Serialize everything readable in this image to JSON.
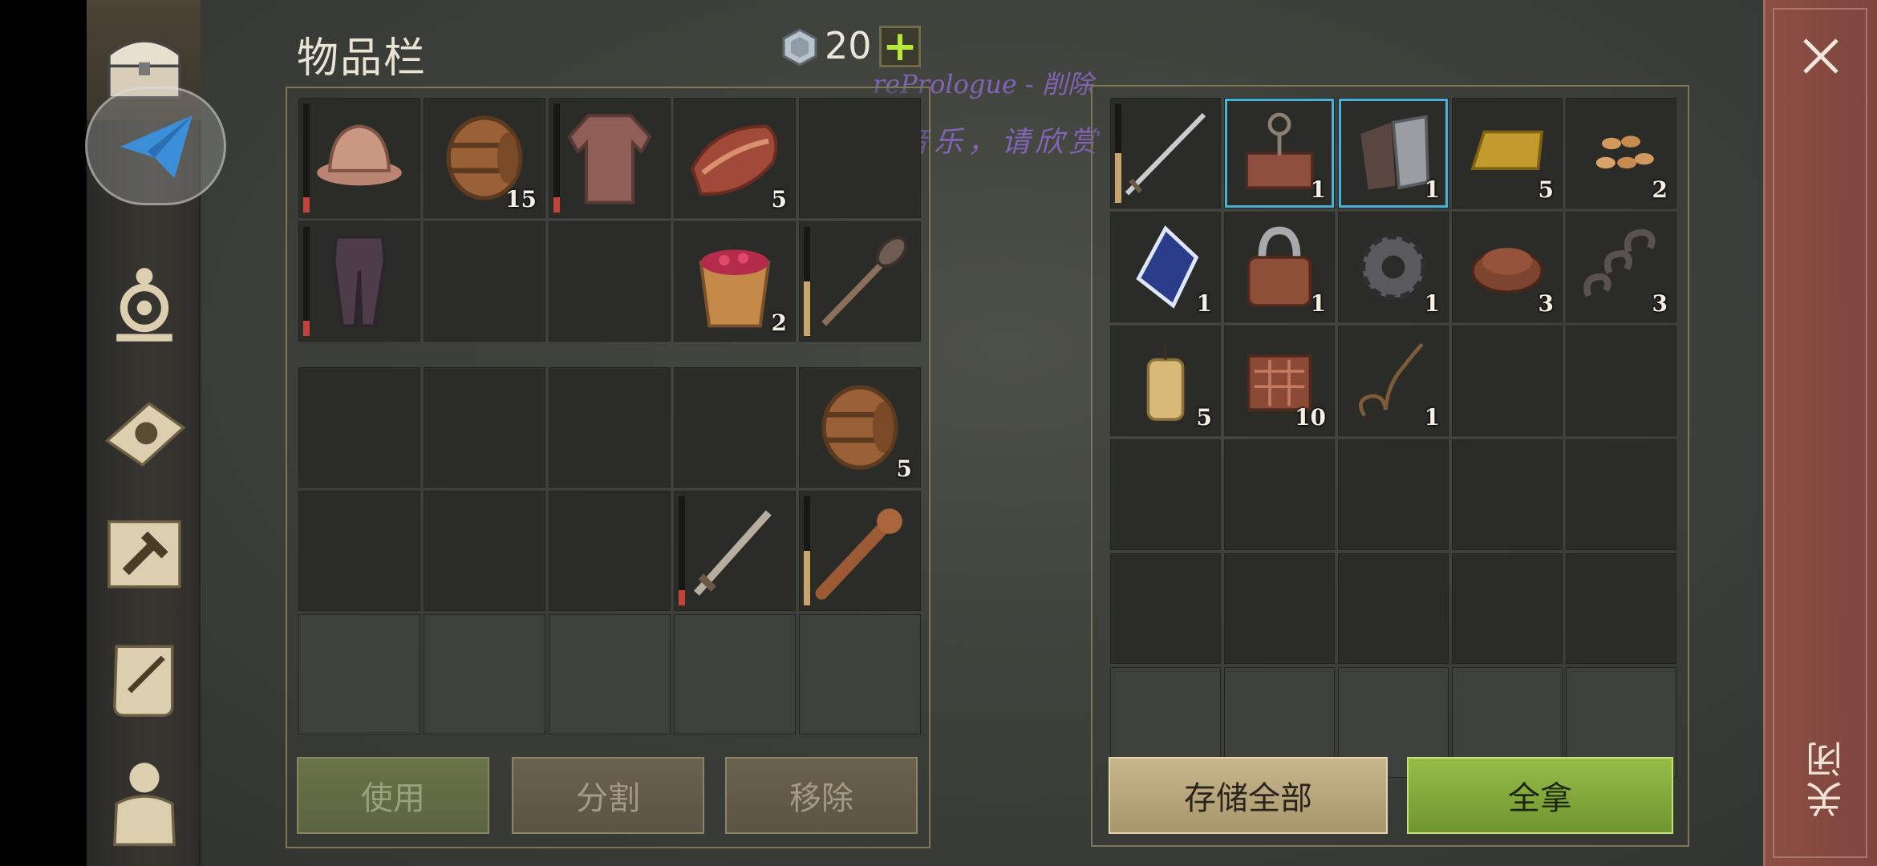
{
  "inventory": {
    "title": "物品栏",
    "currency": {
      "value": "20",
      "icon": "stone-coin-icon",
      "add": "+"
    }
  },
  "overlay": {
    "line1": "rePrologue - 削除",
    "line2": "纯音乐，请欣赏"
  },
  "player_slots": [
    {
      "item": "helmet-icon",
      "qty": "",
      "durability": "red"
    },
    {
      "item": "barrel-icon",
      "qty": "15",
      "durability": ""
    },
    {
      "item": "chainmail-icon",
      "qty": "",
      "durability": "red"
    },
    {
      "item": "meat-icon",
      "qty": "5",
      "durability": ""
    },
    {
      "item": "",
      "qty": "",
      "durability": ""
    },
    {
      "item": "pants-icon",
      "qty": "",
      "durability": "red"
    },
    {
      "item": "",
      "qty": "",
      "durability": ""
    },
    {
      "item": "",
      "qty": "",
      "durability": ""
    },
    {
      "item": "berry-bucket-icon",
      "qty": "2",
      "durability": ""
    },
    {
      "item": "mace-icon",
      "qty": "",
      "durability": "tan"
    }
  ],
  "backpack_slots": [
    {
      "item": "",
      "qty": "",
      "durability": ""
    },
    {
      "item": "",
      "qty": "",
      "durability": ""
    },
    {
      "item": "",
      "qty": "",
      "durability": ""
    },
    {
      "item": "",
      "qty": "",
      "durability": ""
    },
    {
      "item": "barrel-icon",
      "qty": "5",
      "durability": ""
    },
    {
      "item": "",
      "qty": "",
      "durability": ""
    },
    {
      "item": "",
      "qty": "",
      "durability": ""
    },
    {
      "item": "",
      "qty": "",
      "durability": ""
    },
    {
      "item": "sword-icon",
      "qty": "",
      "durability": "red"
    },
    {
      "item": "club-icon",
      "qty": "",
      "durability": "tan"
    },
    {
      "item": "",
      "qty": "",
      "durability": "",
      "locked": true
    },
    {
      "item": "",
      "qty": "",
      "durability": "",
      "locked": true
    },
    {
      "item": "",
      "qty": "",
      "durability": "",
      "locked": true
    },
    {
      "item": "",
      "qty": "",
      "durability": "",
      "locked": true
    },
    {
      "item": "",
      "qty": "",
      "durability": "",
      "locked": true
    }
  ],
  "storage_slots": [
    {
      "item": "long-sword-icon",
      "qty": "",
      "durability": "tan"
    },
    {
      "item": "trap-icon",
      "qty": "1",
      "durability": "",
      "selected": true
    },
    {
      "item": "gauntlets-icon",
      "qty": "1",
      "durability": "",
      "selected": true
    },
    {
      "item": "ingot-icon",
      "qty": "5",
      "durability": ""
    },
    {
      "item": "seeds-icon",
      "qty": "2",
      "durability": ""
    },
    {
      "item": "crystal-icon",
      "qty": "1",
      "durability": ""
    },
    {
      "item": "padlock-icon",
      "qty": "1",
      "durability": ""
    },
    {
      "item": "gear-icon",
      "qty": "1",
      "durability": ""
    },
    {
      "item": "leather-icon",
      "qty": "3",
      "durability": ""
    },
    {
      "item": "chain-icon",
      "qty": "3",
      "durability": ""
    },
    {
      "item": "candle-icon",
      "qty": "5",
      "durability": ""
    },
    {
      "item": "scrap-icon",
      "qty": "10",
      "durability": ""
    },
    {
      "item": "rope-icon",
      "qty": "1",
      "durability": ""
    },
    {
      "item": "",
      "qty": "",
      "durability": ""
    },
    {
      "item": "",
      "qty": "",
      "durability": ""
    },
    {
      "item": "",
      "qty": "",
      "durability": ""
    },
    {
      "item": "",
      "qty": "",
      "durability": ""
    },
    {
      "item": "",
      "qty": "",
      "durability": ""
    },
    {
      "item": "",
      "qty": "",
      "durability": ""
    },
    {
      "item": "",
      "qty": "",
      "durability": ""
    },
    {
      "item": "",
      "qty": "",
      "durability": ""
    },
    {
      "item": "",
      "qty": "",
      "durability": ""
    },
    {
      "item": "",
      "qty": "",
      "durability": ""
    },
    {
      "item": "",
      "qty": "",
      "durability": ""
    },
    {
      "item": "",
      "qty": "",
      "durability": ""
    },
    {
      "item": "",
      "qty": "",
      "durability": "",
      "locked": true
    },
    {
      "item": "",
      "qty": "",
      "durability": "",
      "locked": true
    },
    {
      "item": "",
      "qty": "",
      "durability": "",
      "locked": true
    },
    {
      "item": "",
      "qty": "",
      "durability": "",
      "locked": true
    },
    {
      "item": "",
      "qty": "",
      "durability": "",
      "locked": true
    }
  ],
  "actions": {
    "use": "使用",
    "split": "分割",
    "remove": "移除",
    "store_all": "存储全部",
    "take_all": "全拿",
    "close": "关闭"
  }
}
